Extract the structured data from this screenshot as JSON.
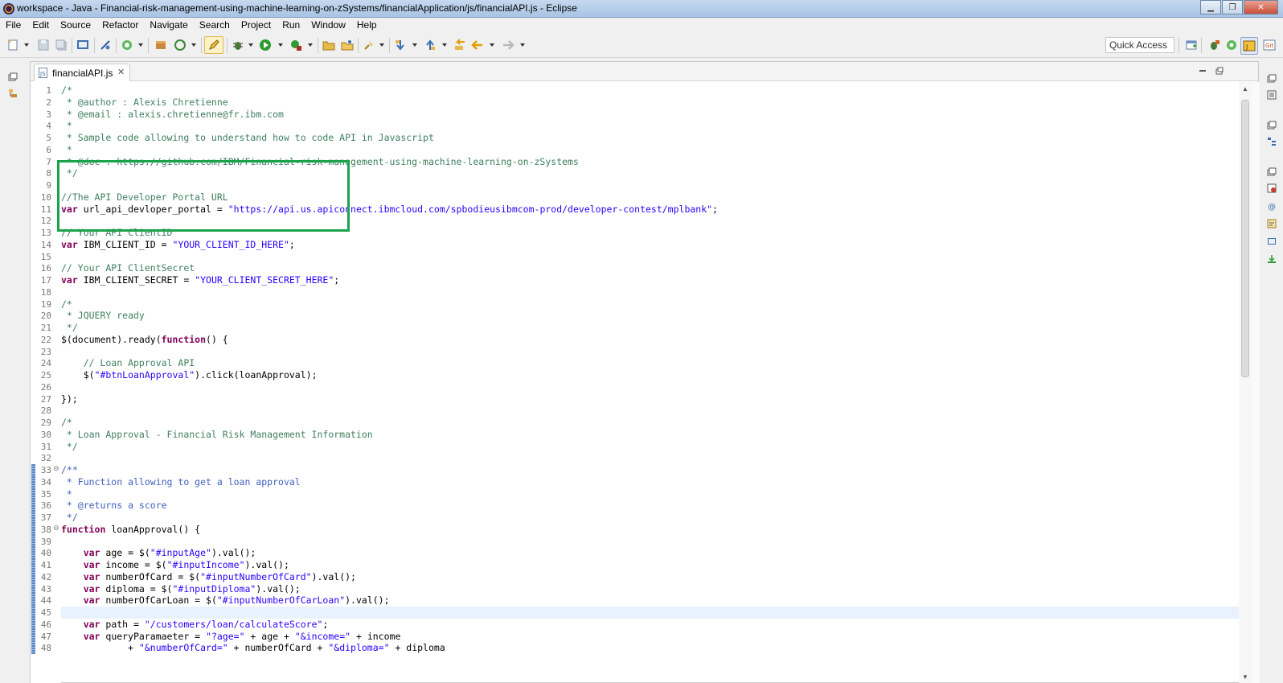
{
  "window": {
    "title": "workspace - Java - Financial-risk-management-using-machine-learning-on-zSystems/financialApplication/js/financialAPI.js - Eclipse",
    "minimize_glyph": "▁",
    "restore_glyph": "❐",
    "close_glyph": "✕"
  },
  "menu": [
    "File",
    "Edit",
    "Source",
    "Refactor",
    "Navigate",
    "Search",
    "Project",
    "Run",
    "Window",
    "Help"
  ],
  "toolbar": {
    "quick_access_label": "Quick Access"
  },
  "editor": {
    "tab_label": "financialAPI.js",
    "tab_close": "✕"
  },
  "code": [
    {
      "n": "1",
      "segs": [
        [
          "cm",
          "/*"
        ]
      ]
    },
    {
      "n": "2",
      "segs": [
        [
          "cm",
          " * @author : Alexis Chretienne"
        ]
      ]
    },
    {
      "n": "3",
      "segs": [
        [
          "cm",
          " * @email : alexis.chretienne@fr.ibm.com"
        ]
      ]
    },
    {
      "n": "4",
      "segs": [
        [
          "cm",
          " *"
        ]
      ]
    },
    {
      "n": "5",
      "segs": [
        [
          "cm",
          " * Sample code allowing to understand how to code API in Javascript"
        ]
      ]
    },
    {
      "n": "6",
      "segs": [
        [
          "cm",
          " *"
        ]
      ]
    },
    {
      "n": "7",
      "segs": [
        [
          "cm",
          " * @doc : https://github.com/IBM/Financial-risk-management-using-machine-learning-on-zSystems"
        ]
      ]
    },
    {
      "n": "8",
      "segs": [
        [
          "cm",
          " */"
        ]
      ]
    },
    {
      "n": "9",
      "segs": []
    },
    {
      "n": "10",
      "segs": [
        [
          "cm",
          "//The API Developer Portal URL"
        ]
      ]
    },
    {
      "n": "11",
      "segs": [
        [
          "kw",
          "var"
        ],
        [
          "fn",
          " url_api_devloper_portal = "
        ],
        [
          "st",
          "\"https://api.us.apiconnect.ibmcloud.com/spbodieusibmcom-prod/developer-contest/mplbank\""
        ],
        [
          "fn",
          ";"
        ]
      ]
    },
    {
      "n": "12",
      "segs": []
    },
    {
      "n": "13",
      "segs": [
        [
          "cm",
          "// Your API ClientID"
        ]
      ]
    },
    {
      "n": "14",
      "segs": [
        [
          "kw",
          "var"
        ],
        [
          "fn",
          " IBM_CLIENT_ID = "
        ],
        [
          "st",
          "\"YOUR_CLIENT_ID_HERE\""
        ],
        [
          "fn",
          ";"
        ]
      ]
    },
    {
      "n": "15",
      "segs": []
    },
    {
      "n": "16",
      "segs": [
        [
          "cm",
          "// Your API ClientSecret"
        ]
      ]
    },
    {
      "n": "17",
      "segs": [
        [
          "kw",
          "var"
        ],
        [
          "fn",
          " IBM_CLIENT_SECRET = "
        ],
        [
          "st",
          "\"YOUR_CLIENT_SECRET_HERE\""
        ],
        [
          "fn",
          ";"
        ]
      ]
    },
    {
      "n": "18",
      "segs": []
    },
    {
      "n": "19",
      "segs": [
        [
          "cm",
          "/*"
        ]
      ]
    },
    {
      "n": "20",
      "segs": [
        [
          "cm",
          " * JQUERY ready"
        ]
      ]
    },
    {
      "n": "21",
      "segs": [
        [
          "cm",
          " */"
        ]
      ]
    },
    {
      "n": "22",
      "segs": [
        [
          "fn",
          "$(document).ready("
        ],
        [
          "kw",
          "function"
        ],
        [
          "fn",
          "() {"
        ]
      ]
    },
    {
      "n": "23",
      "segs": []
    },
    {
      "n": "24",
      "segs": [
        [
          "cm",
          "    // Loan Approval API"
        ]
      ]
    },
    {
      "n": "25",
      "segs": [
        [
          "fn",
          "    $("
        ],
        [
          "st",
          "\"#btnLoanApproval\""
        ],
        [
          "fn",
          ").click(loanApproval);"
        ]
      ]
    },
    {
      "n": "26",
      "segs": []
    },
    {
      "n": "27",
      "segs": [
        [
          "fn",
          "});"
        ]
      ]
    },
    {
      "n": "28",
      "segs": []
    },
    {
      "n": "29",
      "segs": [
        [
          "cm",
          "/*"
        ]
      ]
    },
    {
      "n": "30",
      "segs": [
        [
          "cm",
          " * Loan Approval - Financial Risk Management Information"
        ]
      ]
    },
    {
      "n": "31",
      "segs": [
        [
          "cm",
          " */"
        ]
      ]
    },
    {
      "n": "32",
      "segs": []
    },
    {
      "n": "33",
      "segs": [
        [
          "jd",
          "/**"
        ]
      ]
    },
    {
      "n": "34",
      "segs": [
        [
          "jd",
          " * Function allowing to get a loan approval"
        ]
      ]
    },
    {
      "n": "35",
      "segs": [
        [
          "jd",
          " *"
        ]
      ]
    },
    {
      "n": "36",
      "segs": [
        [
          "jd",
          " * @returns a score"
        ]
      ]
    },
    {
      "n": "37",
      "segs": [
        [
          "jd",
          " */"
        ]
      ]
    },
    {
      "n": "38",
      "segs": [
        [
          "kw",
          "function"
        ],
        [
          "fn",
          " loanApproval() {"
        ]
      ]
    },
    {
      "n": "39",
      "segs": []
    },
    {
      "n": "40",
      "segs": [
        [
          "kw",
          "    var"
        ],
        [
          "fn",
          " age = $("
        ],
        [
          "st",
          "\"#inputAge\""
        ],
        [
          "fn",
          ").val();"
        ]
      ]
    },
    {
      "n": "41",
      "segs": [
        [
          "kw",
          "    var"
        ],
        [
          "fn",
          " income = $("
        ],
        [
          "st",
          "\"#inputIncome\""
        ],
        [
          "fn",
          ").val();"
        ]
      ]
    },
    {
      "n": "42",
      "segs": [
        [
          "kw",
          "    var"
        ],
        [
          "fn",
          " numberOfCard = $("
        ],
        [
          "st",
          "\"#inputNumberOfCard\""
        ],
        [
          "fn",
          ").val();"
        ]
      ]
    },
    {
      "n": "43",
      "segs": [
        [
          "kw",
          "    var"
        ],
        [
          "fn",
          " diploma = $("
        ],
        [
          "st",
          "\"#inputDiploma\""
        ],
        [
          "fn",
          ").val();"
        ]
      ]
    },
    {
      "n": "44",
      "segs": [
        [
          "kw",
          "    var"
        ],
        [
          "fn",
          " numberOfCarLoan = $("
        ],
        [
          "st",
          "\"#inputNumberOfCarLoan\""
        ],
        [
          "fn",
          ").val();"
        ]
      ]
    },
    {
      "n": "45",
      "segs": []
    },
    {
      "n": "46",
      "segs": [
        [
          "kw",
          "    var"
        ],
        [
          "fn",
          " path = "
        ],
        [
          "st",
          "\"/customers/loan/calculateScore\""
        ],
        [
          "fn",
          ";"
        ]
      ]
    },
    {
      "n": "47",
      "segs": [
        [
          "kw",
          "    var"
        ],
        [
          "fn",
          " queryParamaeter = "
        ],
        [
          "st",
          "\"?age=\""
        ],
        [
          "fn",
          " + age + "
        ],
        [
          "st",
          "\"&income=\""
        ],
        [
          "fn",
          " + income"
        ]
      ]
    },
    {
      "n": "48",
      "segs": [
        [
          "fn",
          "            + "
        ],
        [
          "st",
          "\"&numberOfCard=\""
        ],
        [
          "fn",
          " + numberOfCard + "
        ],
        [
          "st",
          "\"&diploma=\""
        ],
        [
          "fn",
          " + diploma"
        ]
      ]
    }
  ],
  "colors": {
    "keyword": "#7f0055",
    "comment": "#3f7f5f",
    "javadoc": "#3f5fbf",
    "string": "#2a00ff",
    "highlight_box": "#1aa34a",
    "current_line": "#e8f2fe"
  },
  "icons": [
    "eclipse-icon",
    "new-icon",
    "save-icon",
    "save-all-icon",
    "run-icon",
    "debug-icon",
    "search-icon",
    "back-icon",
    "forward-icon"
  ]
}
